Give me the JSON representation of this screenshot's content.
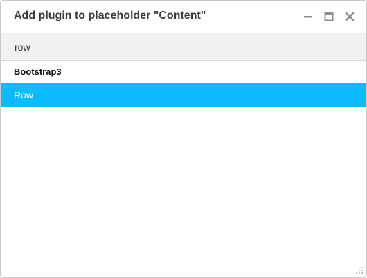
{
  "dialog": {
    "title": "Add plugin to placeholder \"Content\""
  },
  "window_controls": [
    {
      "name": "minimize-icon"
    },
    {
      "name": "maximize-icon"
    },
    {
      "name": "close-icon"
    }
  ],
  "search": {
    "value": "row"
  },
  "plugin_groups": [
    {
      "title": "Bootstrap3",
      "items": [
        {
          "label": "Row",
          "selected": true
        }
      ]
    }
  ],
  "colors": {
    "accent": "#0bbaff",
    "title_text": "#3a3a3a",
    "icon_gray": "#8e8e8e",
    "search_bg": "#f1f1f1"
  }
}
